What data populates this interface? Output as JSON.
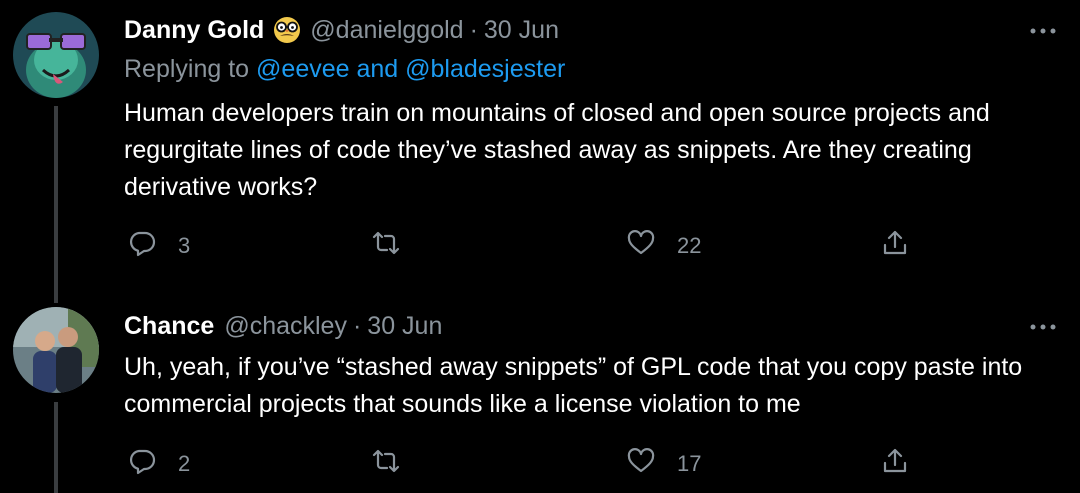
{
  "tweets": [
    {
      "display_name": "Danny Gold",
      "emoji_icon": "disguise-face-icon",
      "handle": "@danielggold",
      "separator": "·",
      "date": "30 Jun",
      "replying_prefix": "Replying to ",
      "replying_mentions": "@eevee and @bladesjester",
      "text": "Human developers train on mountains of closed and open source projects and regurgitate lines of code they’ve stashed away as snippets. Are they creating derivative works?",
      "reply_count": "3",
      "retweet_count": "",
      "like_count": "22"
    },
    {
      "display_name": "Chance",
      "handle": "@chackley",
      "separator": "·",
      "date": "30 Jun",
      "text": "Uh, yeah, if you’ve “stashed away snippets” of GPL code that you copy paste into commercial projects that sounds like a license violation to me",
      "reply_count": "2",
      "retweet_count": "",
      "like_count": "17"
    }
  ],
  "colors": {
    "background": "#000000",
    "primary_text": "#ffffff",
    "secondary_text": "#8b949c",
    "link": "#1d9bf0",
    "thread_line": "#3a3d40"
  }
}
